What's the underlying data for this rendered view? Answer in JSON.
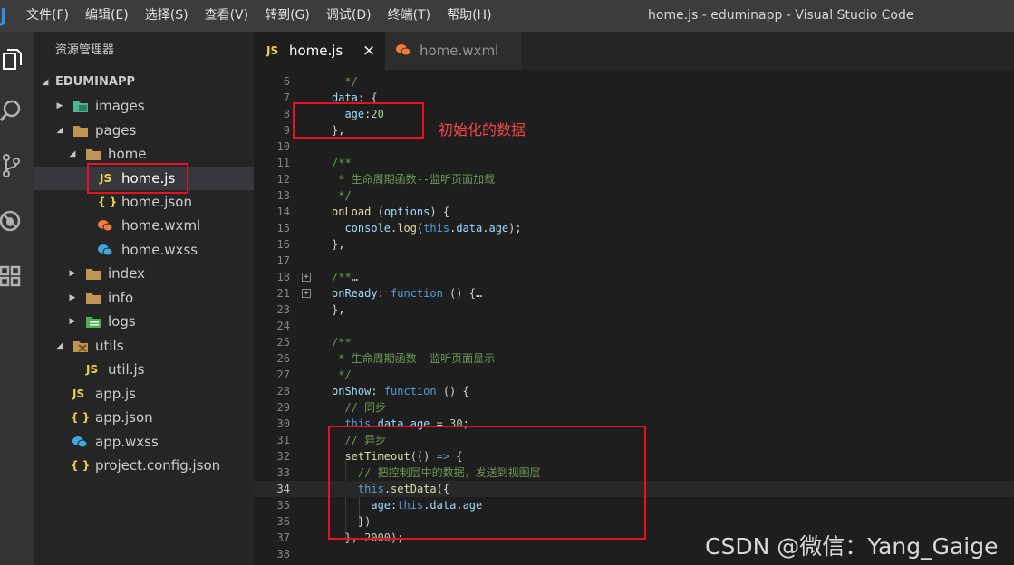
{
  "window": {
    "title": "home.js - eduminapp - Visual Studio Code",
    "menu": [
      "文件(F)",
      "编辑(E)",
      "选择(S)",
      "查看(V)",
      "转到(G)",
      "调试(D)",
      "终端(T)",
      "帮助(H)"
    ]
  },
  "activity_bar": [
    "explorer-icon",
    "search-icon",
    "source-control-icon",
    "debug-icon",
    "extensions-icon"
  ],
  "sidebar": {
    "title": "资源管理器",
    "root": "EDUMINAPP",
    "items": [
      {
        "label": "images",
        "type": "folder",
        "icon": "images-folder-icon",
        "expanded": false
      },
      {
        "label": "pages",
        "type": "folder",
        "icon": "folder-icon",
        "expanded": true
      },
      {
        "label": "home",
        "type": "folder",
        "icon": "folder-icon",
        "expanded": true
      },
      {
        "label": "home.js",
        "type": "file",
        "icon": "js-file-icon",
        "badge": "JS",
        "selected": true
      },
      {
        "label": "home.json",
        "type": "file",
        "icon": "json-file-icon",
        "badge": "{ }"
      },
      {
        "label": "home.wxml",
        "type": "file",
        "icon": "wechat-file-icon"
      },
      {
        "label": "home.wxss",
        "type": "file",
        "icon": "wechat-style-file-icon"
      },
      {
        "label": "index",
        "type": "folder",
        "icon": "folder-icon",
        "expanded": false
      },
      {
        "label": "info",
        "type": "folder",
        "icon": "folder-icon",
        "expanded": false
      },
      {
        "label": "logs",
        "type": "folder",
        "icon": "logs-folder-icon",
        "expanded": false
      },
      {
        "label": "utils",
        "type": "folder",
        "icon": "utils-folder-icon",
        "expanded": true
      },
      {
        "label": "util.js",
        "type": "file",
        "icon": "js-file-icon",
        "badge": "JS"
      },
      {
        "label": "app.js",
        "type": "file",
        "icon": "js-file-icon",
        "badge": "JS"
      },
      {
        "label": "app.json",
        "type": "file",
        "icon": "json-file-icon",
        "badge": "{ }"
      },
      {
        "label": "app.wxss",
        "type": "file",
        "icon": "wechat-style-file-icon"
      },
      {
        "label": "project.config.json",
        "type": "file",
        "icon": "json-file-icon",
        "badge": "{ }"
      }
    ]
  },
  "tabs": [
    {
      "label": "home.js",
      "badge": "JS",
      "active": true,
      "close": "×"
    },
    {
      "label": "home.wxml",
      "active": false
    }
  ],
  "editor": {
    "current_line": "34",
    "lines": [
      {
        "n": "6",
        "tokens": [
          [
            "c",
            "  */"
          ]
        ]
      },
      {
        "n": "7",
        "tokens": [
          [
            "p",
            "data"
          ],
          [
            "t",
            ": {"
          ]
        ]
      },
      {
        "n": "8",
        "tokens": [
          [
            "t",
            "  "
          ],
          [
            "p",
            "age"
          ],
          [
            "t",
            ":"
          ],
          [
            "n",
            "20"
          ]
        ]
      },
      {
        "n": "9",
        "tokens": [
          [
            "t",
            "},"
          ]
        ]
      },
      {
        "n": "10",
        "tokens": []
      },
      {
        "n": "11",
        "tokens": [
          [
            "c",
            "/**"
          ]
        ]
      },
      {
        "n": "12",
        "tokens": [
          [
            "c",
            " * 生命周期函数--监听页面加载"
          ]
        ]
      },
      {
        "n": "13",
        "tokens": [
          [
            "c",
            " */"
          ]
        ]
      },
      {
        "n": "14",
        "tokens": [
          [
            "f",
            "onLoad"
          ],
          [
            "t",
            " ("
          ],
          [
            "p",
            "options"
          ],
          [
            "t",
            ") {"
          ]
        ]
      },
      {
        "n": "15",
        "tokens": [
          [
            "t",
            "  "
          ],
          [
            "p",
            "console"
          ],
          [
            "t",
            "."
          ],
          [
            "f",
            "log"
          ],
          [
            "t",
            "("
          ],
          [
            "k",
            "this"
          ],
          [
            "t",
            "."
          ],
          [
            "p",
            "data"
          ],
          [
            "t",
            "."
          ],
          [
            "p",
            "age"
          ],
          [
            "t",
            ");"
          ]
        ]
      },
      {
        "n": "16",
        "tokens": [
          [
            "t",
            "},"
          ]
        ]
      },
      {
        "n": "17",
        "tokens": []
      },
      {
        "n": "18",
        "fold": "+",
        "tokens": [
          [
            "c",
            "/**"
          ],
          [
            "t",
            "…"
          ]
        ]
      },
      {
        "n": "21",
        "fold": "+",
        "tokens": [
          [
            "p",
            "onReady"
          ],
          [
            "t",
            ": "
          ],
          [
            "k",
            "function"
          ],
          [
            "t",
            " () {…"
          ]
        ]
      },
      {
        "n": "23",
        "tokens": [
          [
            "t",
            "},"
          ]
        ]
      },
      {
        "n": "24",
        "tokens": []
      },
      {
        "n": "25",
        "tokens": [
          [
            "c",
            "/**"
          ]
        ]
      },
      {
        "n": "26",
        "tokens": [
          [
            "c",
            " * 生命周期函数--监听页面显示"
          ]
        ]
      },
      {
        "n": "27",
        "tokens": [
          [
            "c",
            " */"
          ]
        ]
      },
      {
        "n": "28",
        "tokens": [
          [
            "p",
            "onShow"
          ],
          [
            "t",
            ": "
          ],
          [
            "k",
            "function"
          ],
          [
            "t",
            " () {"
          ]
        ]
      },
      {
        "n": "29",
        "tokens": [
          [
            "t",
            "  "
          ],
          [
            "c",
            "// 同步"
          ]
        ]
      },
      {
        "n": "30",
        "tokens": [
          [
            "t",
            "  "
          ],
          [
            "k",
            "this"
          ],
          [
            "t",
            "."
          ],
          [
            "p",
            "data"
          ],
          [
            "t",
            "."
          ],
          [
            "p",
            "age"
          ],
          [
            "t",
            " = "
          ],
          [
            "n",
            "30"
          ],
          [
            "t",
            ";"
          ]
        ]
      },
      {
        "n": "31",
        "tokens": [
          [
            "t",
            "  "
          ],
          [
            "c",
            "// 异步"
          ]
        ]
      },
      {
        "n": "32",
        "tokens": [
          [
            "t",
            "  "
          ],
          [
            "f",
            "setTimeout"
          ],
          [
            "t",
            "(() "
          ],
          [
            "k",
            "=>"
          ],
          [
            "t",
            " {"
          ]
        ]
      },
      {
        "n": "33",
        "tokens": [
          [
            "t",
            "    "
          ],
          [
            "c",
            "// 把控制层中的数据，发送到视图层"
          ]
        ]
      },
      {
        "n": "34",
        "tokens": [
          [
            "t",
            "    "
          ],
          [
            "k",
            "this"
          ],
          [
            "t",
            "."
          ],
          [
            "f",
            "setData"
          ],
          [
            "t",
            "({"
          ]
        ]
      },
      {
        "n": "35",
        "tokens": [
          [
            "t",
            "      "
          ],
          [
            "p",
            "age"
          ],
          [
            "t",
            ":"
          ],
          [
            "k",
            "this"
          ],
          [
            "t",
            "."
          ],
          [
            "p",
            "data"
          ],
          [
            "t",
            "."
          ],
          [
            "p",
            "age"
          ]
        ]
      },
      {
        "n": "36",
        "tokens": [
          [
            "t",
            "    })"
          ]
        ]
      },
      {
        "n": "37",
        "tokens": [
          [
            "t",
            "  }, "
          ],
          [
            "n",
            "2000"
          ],
          [
            "t",
            ");"
          ]
        ]
      },
      {
        "n": "38",
        "tokens": []
      }
    ]
  },
  "annotation": {
    "label": "初始化的数据",
    "color": "#e81123"
  },
  "watermark": "CSDN @微信：Yang_Gaige",
  "colors": {
    "accent": "#007acc",
    "highlight_box": "#e81123",
    "editor_bg": "#1e1e1e",
    "sidebar_bg": "#252526"
  }
}
